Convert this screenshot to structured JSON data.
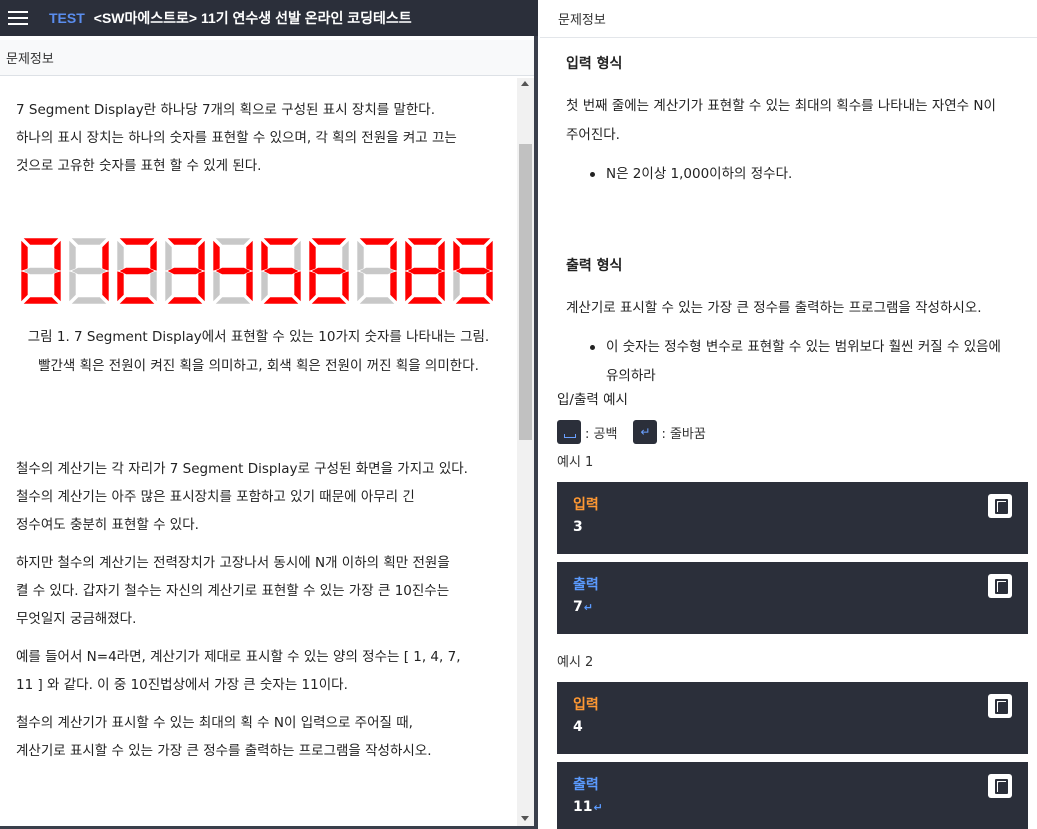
{
  "app": {
    "test_tag": "TEST",
    "title": "<SW마에스트로> 11기 연수생 선발 온라인 코딩테스트",
    "menu_icon": "hamburger-icon"
  },
  "left": {
    "header": "문제정보",
    "intro": [
      "7 Segment Display란 하나당 7개의 획으로 구성된 표시 장치를 말한다.",
      "하나의 표시 장치는 하나의 숫자를 표현할 수 있으며, 각 획의 전원을 켜고 끄는",
      "것으로 고유한 숫자를 표현 할 수 있게 된다."
    ],
    "figure": {
      "digits": [
        "0",
        "1",
        "2",
        "3",
        "4",
        "5",
        "6",
        "7",
        "8",
        "9"
      ],
      "on_color": "#ff0000",
      "off_color": "#c8c8c8",
      "caption_lines": [
        "그림 1. 7 Segment Display에서 표현할 수 있는 10가지 숫자를 나타내는 그림.",
        "빨간색 획은 전원이 켜진 획을 의미하고, 회색 획은 전원이 꺼진 획을 의미한다."
      ]
    },
    "paragraphs": [
      [
        "철수의 계산기는 각 자리가 7 Segment Display로 구성된 화면을 가지고 있다.",
        "철수의 계산기는 아주 많은 표시장치를 포함하고 있기 때문에 아무리 긴",
        "정수여도 충분히 표현할 수 있다."
      ],
      [
        "하지만 철수의 계산기는 전력장치가 고장나서 동시에 N개 이하의 획만 전원을",
        "켤 수 있다. 갑자기 철수는 자신의 계산기로 표현할 수 있는 가장 큰 10진수는",
        "무엇일지 궁금해졌다."
      ],
      [
        "예를 들어서 N=4라면, 계산기가 제대로 표시할 수 있는 양의 정수는 [ 1, 4, 7,",
        "11 ] 와 같다. 이 중 10진법상에서 가장 큰 숫자는 11이다."
      ],
      [
        "철수의 계산기가 표시할 수 있는 최대의 획 수 N이 입력으로 주어질 때,",
        "계산기로 표시할 수 있는 가장 큰 정수를 출력하는 프로그램을 작성하시오."
      ]
    ]
  },
  "right": {
    "header": "문제정보",
    "input_title": "입력 형식",
    "input_desc": [
      "첫 번째 줄에는 계산기가 표현할 수 있는 최대의 획수를 나타내는 자연수 N이",
      "주어진다."
    ],
    "input_bullet": "N은 2이상 1,000이하의 정수다.",
    "output_title": "출력 형식",
    "output_desc": "계산기로 표시할 수 있는 가장 큰 정수를 출력하는 프로그램을 작성하시오.",
    "output_bullet": [
      "이 숫자는 정수형 변수로 표현할 수 있는 범위보다 훨씬 커질 수 있음에",
      "유의하라"
    ],
    "io_title": "입/출력 예시",
    "legend": {
      "space_label": ": 공백",
      "newline_label": ": 줄바꿈",
      "newline_glyph": "↵"
    },
    "examples": [
      {
        "label": "예시 1",
        "input_key": "입력",
        "input_value": "3",
        "output_key": "출력",
        "output_value": "7"
      },
      {
        "label": "예시 2",
        "input_key": "입력",
        "input_value": "4",
        "output_key": "출력",
        "output_value": "11"
      }
    ]
  }
}
